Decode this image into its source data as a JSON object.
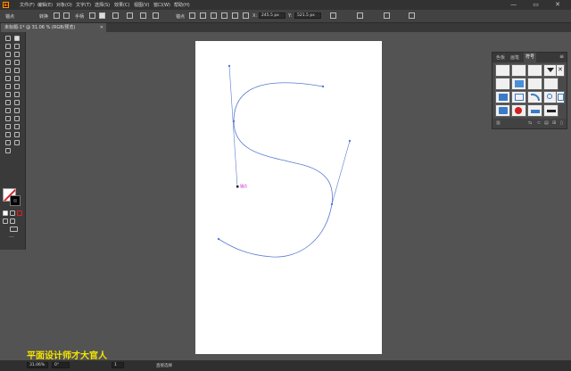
{
  "app": {
    "logo_text": "Ai",
    "menu": [
      "文件(F)",
      "编辑(E)",
      "对象(O)",
      "文字(T)",
      "选择(S)",
      "效果(C)",
      "视图(V)",
      "窗口(W)",
      "帮助(H)"
    ],
    "window_controls": "— ▭ ✕"
  },
  "control_bar": {
    "label_anchor": "锚点",
    "label_convert": "转换",
    "label_handle": "手柄",
    "label_anchor2": "锚点",
    "x_value": "245.5 px",
    "y_value": "521.5 px"
  },
  "document": {
    "tab_title": "未标题-1* @ 31.06 % (RGB/预览)",
    "close": "✕"
  },
  "canvas": {
    "anchor_label": "锚点"
  },
  "panel": {
    "tabs": [
      "色板",
      "画笔",
      "符号"
    ],
    "active_tab": 2,
    "menu_icon": "≡"
  },
  "status": {
    "zoom": "31.06%",
    "rotation": "0°",
    "page": "1",
    "tool_name": "直接选择"
  },
  "watermark": "平面设计师才大官人",
  "colors": {
    "accent": "#ff9a00",
    "path": "#5a7bd0",
    "watermark": "#f5e400"
  }
}
